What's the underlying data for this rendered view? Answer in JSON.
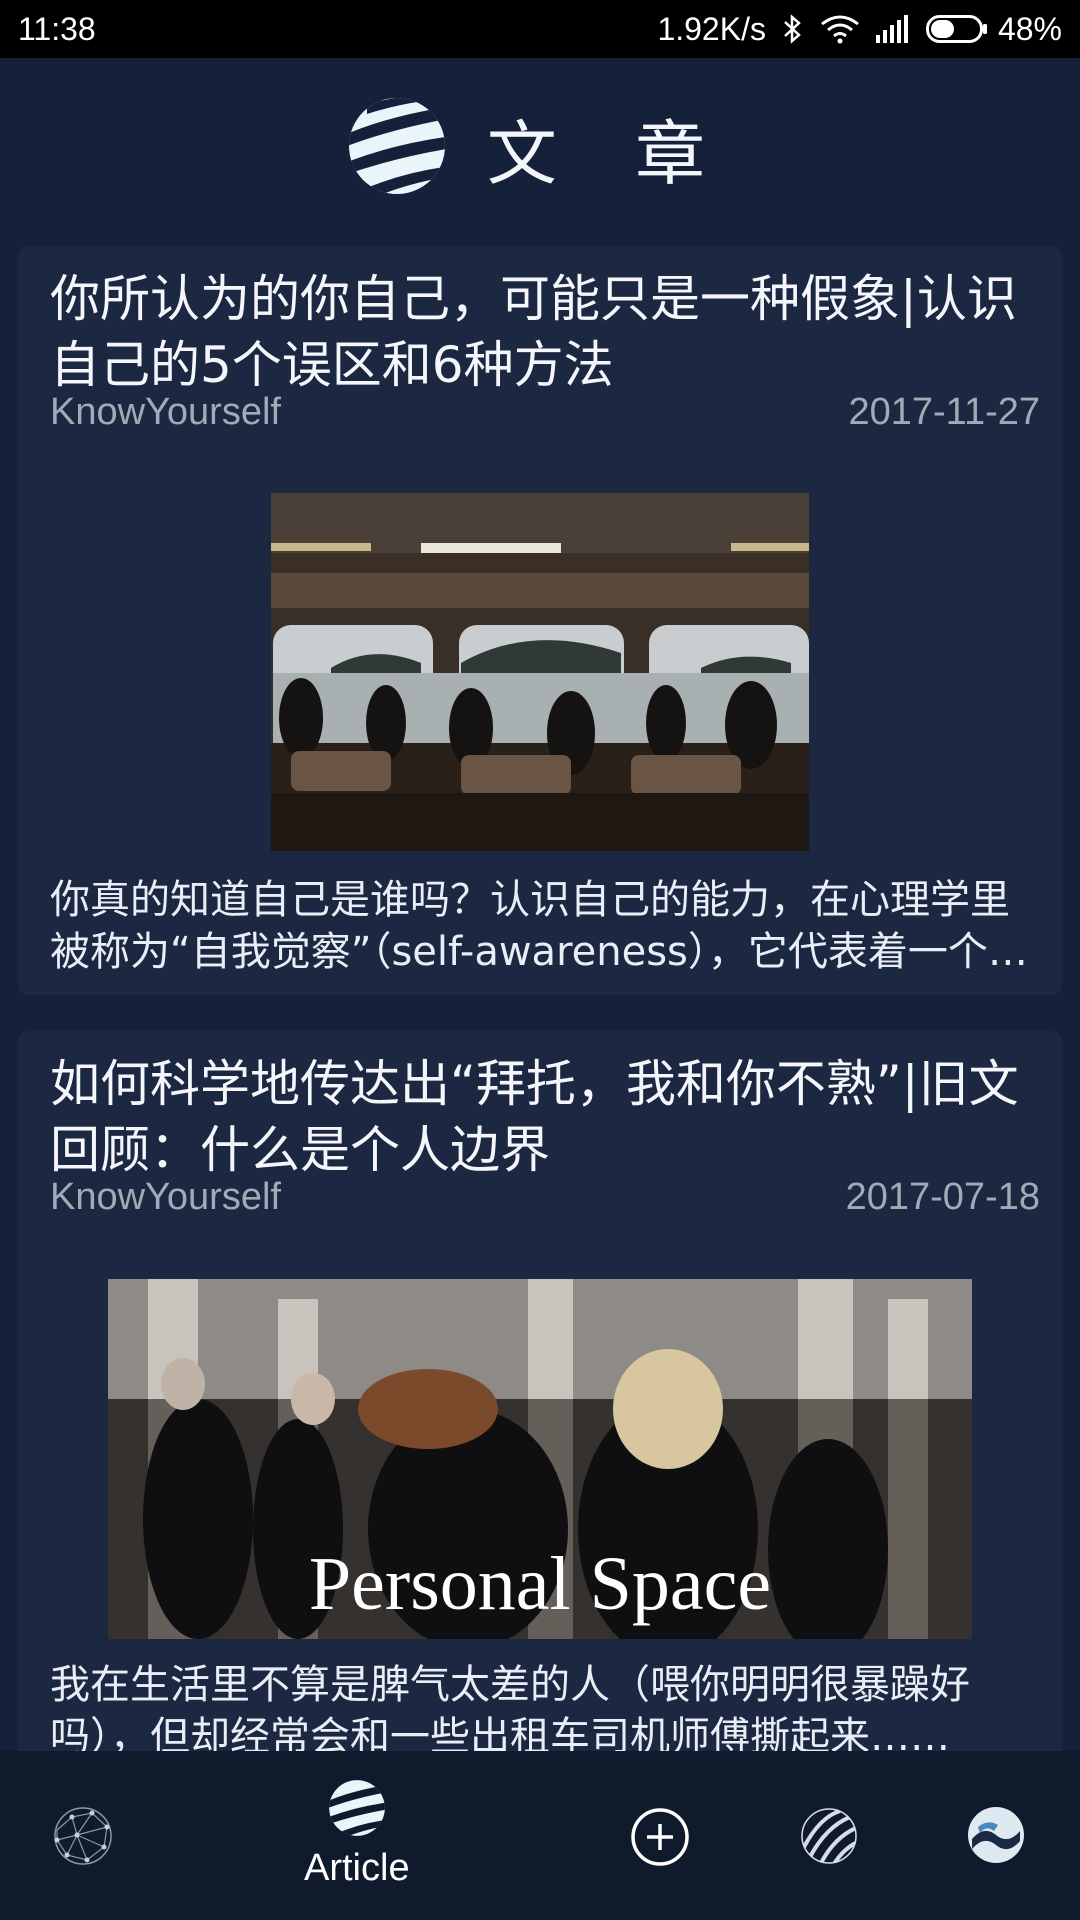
{
  "status_bar": {
    "time": "11:38",
    "network_speed": "1.92K/s",
    "battery_percent": "48%",
    "battery_level": 0.48,
    "icons": [
      "bluetooth-icon",
      "wifi-icon",
      "signal-icon",
      "battery-icon"
    ]
  },
  "header": {
    "title": "文 章",
    "logo_icon": "globe-stripes-logo-icon"
  },
  "articles": [
    {
      "title": "你所认为的你自己，可能只是一种假象|认识自己的5个误区和6种方法",
      "author": "KnowYourself",
      "date": "2017-11-27",
      "excerpt": "你真的知道自己是谁吗？认识自己的能力，在心理学里被称为“自我觉察”（self-awareness），它代表着一个人能够清楚地认识自己的性格、情绪和动机……",
      "image_caption": ""
    },
    {
      "title": "如何科学地传达出“拜托，我和你不熟”|旧文回顾：什么是个人边界",
      "author": "KnowYourself",
      "date": "2017-07-18",
      "excerpt": "我在生活里不算是脾气太差的人（喂你明明很暴躁好吗），但却经常会和一些出租车司机师傅撕起来……",
      "image_caption": "Personal Space"
    }
  ],
  "bottom_nav": {
    "items": [
      {
        "icon": "network-globe-icon",
        "label": ""
      },
      {
        "icon": "striped-globe-icon",
        "label": "Article"
      },
      {
        "icon": "add-circle-icon",
        "label": ""
      },
      {
        "icon": "wave-globe-icon",
        "label": ""
      },
      {
        "icon": "profile-logo-icon",
        "label": ""
      }
    ],
    "active_index": 1
  },
  "colors": {
    "background": "#15203a",
    "card": "#1c2841",
    "meta_text": "#a3a9b5",
    "nav_bar": "#0f1a2d"
  }
}
